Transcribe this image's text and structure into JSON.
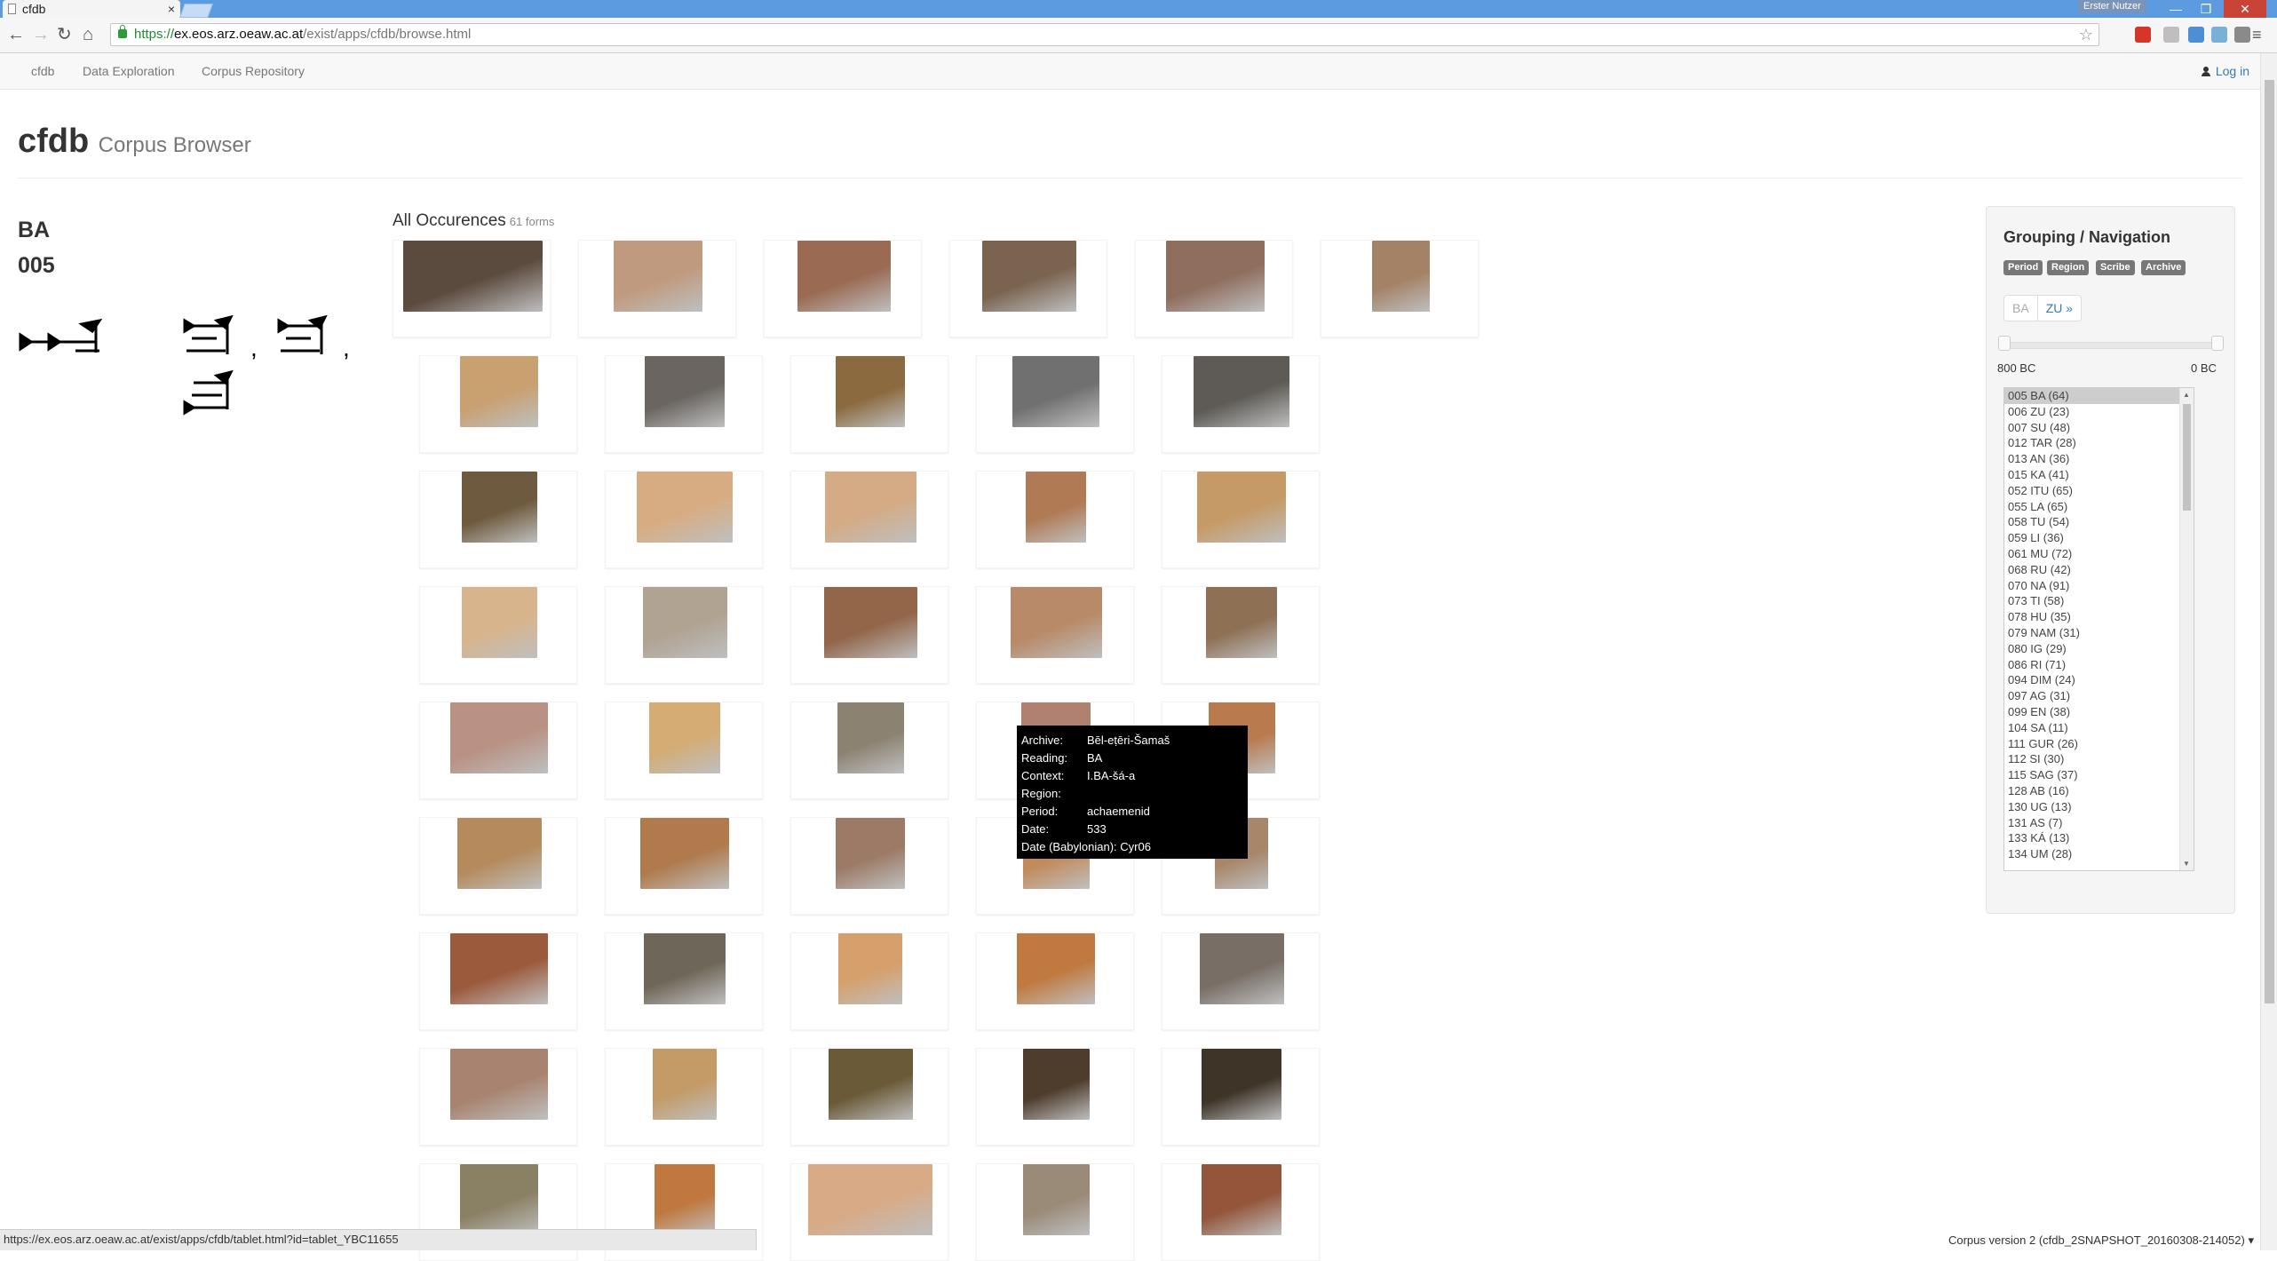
{
  "browser": {
    "tab_title": "cfdb",
    "tab_close": "×",
    "window_user": "Erster Nutzer",
    "url_scheme": "https://",
    "url_host": "ex.eos.arz.oeaw.ac.at",
    "url_path": "/exist/apps/cfdb/browse.html",
    "back": "←",
    "forward": "→",
    "reload": "↻",
    "home": "⌂",
    "bookmark": "☆",
    "menu": "≡",
    "minimize": "—",
    "maximize": "❐",
    "close": "✕"
  },
  "nav": {
    "items": [
      "cfdb",
      "Data Exploration",
      "Corpus Repository"
    ],
    "login": "Log in"
  },
  "header": {
    "brand": "cfdb",
    "subtitle": "Corpus Browser"
  },
  "sign": {
    "reading": "BA",
    "number": "005"
  },
  "occurrences": {
    "title": "All Occurences",
    "count": "61 forms",
    "rows": [
      [
        "#5b4a3e",
        "#c09a7e",
        "#9a6a52",
        "#7a6450",
        "#8f6e5e",
        "#a38266"
      ],
      [
        "#c9a070",
        "#6a6560",
        "#8a6a3e",
        "#707070",
        "#5e5b56"
      ],
      [
        "#6e5a3e",
        "#d8ac82",
        "#d4ab85",
        "#b07a55",
        "#c69a66"
      ],
      [
        "#d8b48c",
        "#b0a392",
        "#93664a",
        "#b98a68",
        "#8e7055"
      ],
      [
        "#b99284",
        "#d4ac74",
        "#8c8272",
        "#b08070",
        "#b97a4e"
      ],
      [
        "#b58a5c",
        "#b07a4c",
        "#9c7a66",
        "#c38a5a",
        "#a8866a"
      ],
      [
        "#9c5a3c",
        "#6e6658",
        "#d6a06c",
        "#c07a40",
        "#786e66"
      ],
      [
        "#a88470",
        "#c49a66",
        "#6a5a38",
        "#4e3c2c",
        "#3e3428"
      ],
      [
        "#8a8064",
        "#c0783e",
        "#d8aa86",
        "#9a8a78",
        "#94553a"
      ]
    ]
  },
  "tooltip": {
    "rows": [
      {
        "k": "Archive:",
        "v": "Bēl-eṭēri-Šamaš"
      },
      {
        "k": "Reading:",
        "v": "BA"
      },
      {
        "k": "Context:",
        "v": "I.BA-šá-a"
      },
      {
        "k": "Region:",
        "v": ""
      },
      {
        "k": "Period:",
        "v": "achaemenid"
      },
      {
        "k": "Date:",
        "v": "533"
      },
      {
        "k": "Date (Babylonian):",
        "v": "Cyr06"
      }
    ]
  },
  "panel": {
    "title": "Grouping / Navigation",
    "labels": [
      "Period",
      "Region",
      "Scribe",
      "Archive"
    ],
    "pager_current": "BA",
    "pager_next": "ZU »",
    "range_min": "800 BC",
    "range_max": "0 BC",
    "slider_low": 0,
    "slider_high": 1,
    "signs": [
      "005 BA (64)",
      "006 ZU (23)",
      "007 SU (48)",
      "012 TAR (28)",
      "013 AN (36)",
      "015 KA (41)",
      "052 ITU (65)",
      "055 LA (65)",
      "058 TU (54)",
      "059 LI (36)",
      "061 MU (72)",
      "068 RU (42)",
      "070 NA (91)",
      "073 TI (58)",
      "078 HU (35)",
      "079 NAM (31)",
      "080 IG (29)",
      "086 RI (71)",
      "094 DIM (24)",
      "097 AG (31)",
      "099 EN (38)",
      "104 SA (11)",
      "111 GUR (26)",
      "112 SI (30)",
      "115 SAG (37)",
      "128 AB (16)",
      "130 UG (13)",
      "131 AS (7)",
      "133 KÁ (13)",
      "134 UM (28)"
    ]
  },
  "status": {
    "url": "https://ex.eos.arz.oeaw.ac.at/exist/apps/cfdb/tablet.html?id=tablet_YBC11655",
    "version": "Corpus version 2 (cfdb_2SNAPSHOT_20160308-214052)",
    "version_caret": "▾"
  },
  "colors": {
    "tab_strip": "#5d9be0",
    "link": "#337ab7",
    "label_bg": "#777777"
  }
}
